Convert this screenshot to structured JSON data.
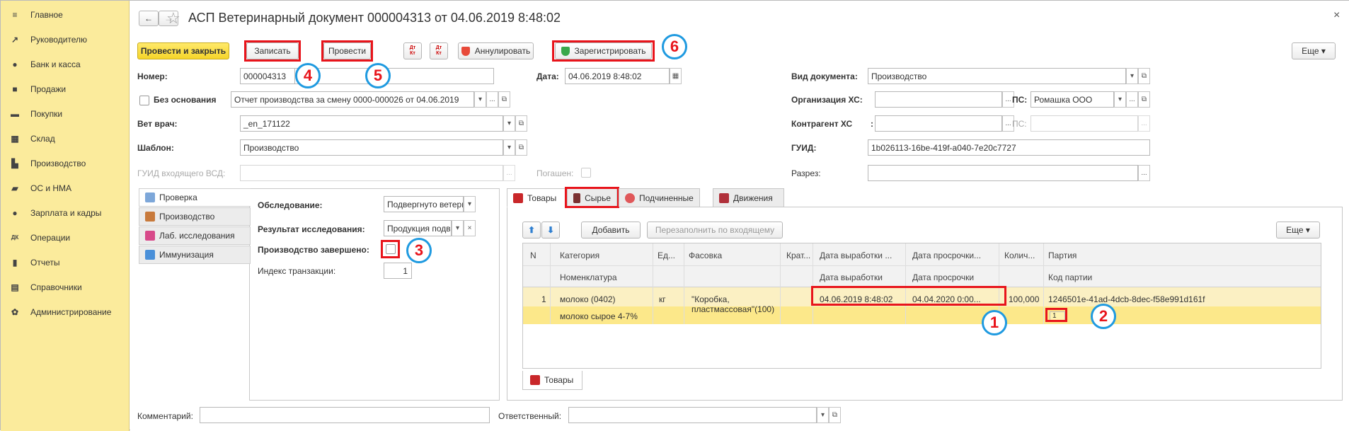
{
  "sidebar": {
    "items": [
      {
        "label": "Главное",
        "icon": "menu-icon"
      },
      {
        "label": "Руководителю",
        "icon": "trend-icon"
      },
      {
        "label": "Банк и касса",
        "icon": "coin-icon"
      },
      {
        "label": "Продажи",
        "icon": "bag-icon"
      },
      {
        "label": "Покупки",
        "icon": "cart-icon"
      },
      {
        "label": "Склад",
        "icon": "warehouse-icon"
      },
      {
        "label": "Производство",
        "icon": "factory-icon"
      },
      {
        "label": "ОС и НМА",
        "icon": "truck-icon"
      },
      {
        "label": "Зарплата и кадры",
        "icon": "person-icon"
      },
      {
        "label": "Операции",
        "icon": "dt-kt-icon"
      },
      {
        "label": "Отчеты",
        "icon": "bar-chart-icon"
      },
      {
        "label": "Справочники",
        "icon": "book-icon"
      },
      {
        "label": "Администрирование",
        "icon": "gear-icon"
      }
    ]
  },
  "window": {
    "title": "АСП Ветеринарный документ 000004313 от 04.06.2019 8:48:02",
    "close": "×",
    "back": "←",
    "forward": "→",
    "star": "☆"
  },
  "toolbar": {
    "post_close": "Провести и закрыть",
    "save": "Записать",
    "post": "Провести",
    "dt1": "Дт Кт",
    "dt2": "Дт Кт",
    "annul": "Аннулировать",
    "register": "Зарегистрировать",
    "more": "Еще ▾"
  },
  "markers": {
    "m1": "1",
    "m2": "2",
    "m3": "3",
    "m4": "4",
    "m5": "5",
    "m6": "6"
  },
  "form": {
    "nomer_label": "Номер:",
    "nomer": "000004313",
    "data_label": "Дата:",
    "data": "04.06.2019  8:48:02",
    "bez_osn_label": "Без основания",
    "osnovanie": "Отчет производства за смену 0000-000026 от 04.06.2019",
    "vet_label": "Вет врач:",
    "vet": "_en_171122",
    "shablon_label": "Шаблон:",
    "shablon": "Производство",
    "guid_vsd_label": "ГУИД входящего ВСД:",
    "pogashen_label": "Погашен:",
    "vid_label": "Вид документа:",
    "vid": "Производство",
    "org_label": "Организация ХС:",
    "org": "",
    "ps_label": "ПС:",
    "ps": "Ромашка ООО",
    "kontr_label": "Контрагент ХС",
    "kontr_colon": ":",
    "kontr": "",
    "ps2_label": "ПС:",
    "guid_label": "ГУИД:",
    "guid": "1b026113-16be-419f-a040-7e20c7727",
    "razrez_label": "Разрез:",
    "comment_label": "Комментарий:",
    "resp_label": "Ответственный:",
    "ellipsis": "...",
    "dropdown": "▾",
    "clear": "×",
    "open": "⧉",
    "cal": "▦"
  },
  "left_tabs": {
    "items": [
      "Проверка",
      "Производство",
      "Лаб. исследования",
      "Иммунизация"
    ],
    "obsl_label": "Обследование:",
    "obsl": "Подвергнуто ветерин",
    "result_label": "Результат исследования:",
    "result": "Продукция подве",
    "done_label": "Производство завершено:",
    "index_label": "Индекс транзакции:",
    "index": "1"
  },
  "right_tabs": {
    "items": [
      "Товары",
      "Сырье",
      "Подчиненные",
      "Движения"
    ],
    "bottom_tab": "Товары"
  },
  "table_toolbar": {
    "add": "Добавить",
    "refill": "Перезаполнить по входящему",
    "more": "Еще ▾"
  },
  "table": {
    "headers_top": [
      "N",
      "Категория",
      "Ед...",
      "Фасовка",
      "Крат...",
      "Дата выработки ...",
      "Дата просрочки...",
      "Колич...",
      "Партия"
    ],
    "headers_bottom": [
      "Номенклатура",
      "Дата выработки",
      "Дата просрочки",
      "Код партии"
    ],
    "row": {
      "n": "1",
      "category": "молоко (0402)",
      "nomenclature": "молоко сырое 4-7%",
      "unit": "кг",
      "pack1": "\"Коробка,",
      "pack2": "пластмассовая\"(100)",
      "date_prod": "04.06.2019 8:48:02",
      "date_exp": "04.04.2020 0:00...",
      "qty": "100,000",
      "party": "1246501e-41ad-4dcb-8dec-f58e991d161f",
      "party_code": "1"
    }
  }
}
